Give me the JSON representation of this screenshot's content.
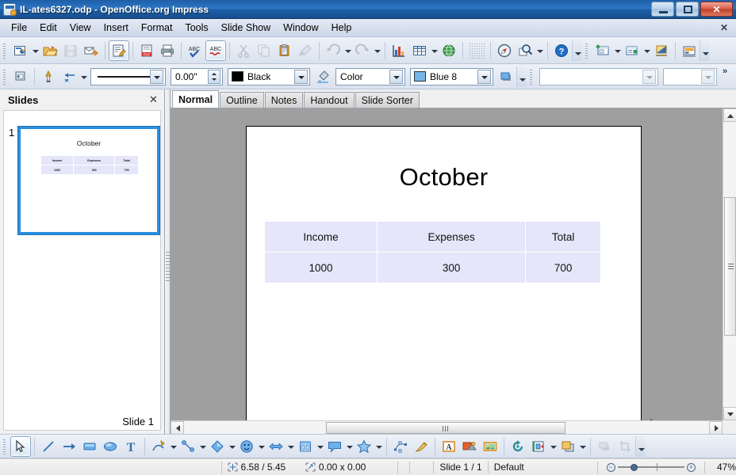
{
  "window": {
    "title": "IL-ates6327.odp - OpenOffice.org Impress",
    "app_icon": "impress-document-icon",
    "controls": {
      "minimize": "minimize-button",
      "restore": "restore-button",
      "close": "✕"
    }
  },
  "menubar": {
    "items": [
      "File",
      "Edit",
      "View",
      "Insert",
      "Format",
      "Tools",
      "Slide Show",
      "Window",
      "Help"
    ],
    "doc_close": "✕"
  },
  "toolbars": {
    "standard": [
      {
        "name": "new-document-icon",
        "kind": "icon",
        "dim": false
      },
      {
        "name": "new-document-dropdown",
        "kind": "arrow"
      },
      {
        "name": "open-icon",
        "kind": "icon",
        "dim": false
      },
      {
        "name": "save-icon",
        "kind": "icon",
        "dim": true
      },
      {
        "name": "email-document-icon",
        "kind": "icon",
        "dim": false
      },
      {
        "name": "separator",
        "kind": "sep"
      },
      {
        "name": "edit-file-icon",
        "kind": "icon",
        "dim": false,
        "pressed": true
      },
      {
        "name": "separator",
        "kind": "sep"
      },
      {
        "name": "export-pdf-icon",
        "kind": "icon",
        "dim": false
      },
      {
        "name": "print-icon",
        "kind": "icon",
        "dim": false
      },
      {
        "name": "separator",
        "kind": "sep"
      },
      {
        "name": "spellcheck-icon",
        "kind": "icon",
        "dim": false
      },
      {
        "name": "autospellcheck-icon",
        "kind": "icon",
        "dim": false,
        "pressed": true
      },
      {
        "name": "separator",
        "kind": "sep"
      },
      {
        "name": "cut-icon",
        "kind": "icon",
        "dim": true
      },
      {
        "name": "copy-icon",
        "kind": "icon",
        "dim": true
      },
      {
        "name": "paste-icon",
        "kind": "icon",
        "dim": false
      },
      {
        "name": "clone-formatting-icon",
        "kind": "icon",
        "dim": true
      },
      {
        "name": "separator",
        "kind": "sep"
      },
      {
        "name": "undo-icon",
        "kind": "icon",
        "dim": true
      },
      {
        "name": "undo-dropdown",
        "kind": "arrow"
      },
      {
        "name": "redo-icon",
        "kind": "icon",
        "dim": true
      },
      {
        "name": "redo-dropdown",
        "kind": "arrow"
      },
      {
        "name": "separator",
        "kind": "sep"
      },
      {
        "name": "insert-chart-icon",
        "kind": "icon",
        "dim": false
      },
      {
        "name": "insert-table-icon",
        "kind": "icon",
        "dim": false
      },
      {
        "name": "insert-table-dropdown",
        "kind": "arrow"
      },
      {
        "name": "hyperlink-icon",
        "kind": "icon",
        "dim": false
      },
      {
        "name": "separator",
        "kind": "sep"
      },
      {
        "name": "display-grid-icon",
        "kind": "dots"
      },
      {
        "name": "separator",
        "kind": "sep"
      },
      {
        "name": "navigator-icon",
        "kind": "icon",
        "dim": false
      },
      {
        "name": "zoom-icon",
        "kind": "icon",
        "dim": false
      },
      {
        "name": "zoom-dropdown",
        "kind": "arrow"
      },
      {
        "name": "separator",
        "kind": "sep"
      },
      {
        "name": "help-icon",
        "kind": "icon",
        "dim": false
      },
      {
        "name": "standard-toolbar-overflow",
        "kind": "overflow"
      },
      {
        "name": "grip",
        "kind": "grip"
      },
      {
        "name": "new-slide-icon",
        "kind": "icon",
        "dim": false
      },
      {
        "name": "new-slide-dropdown",
        "kind": "arrow"
      },
      {
        "name": "slide-layout-icon",
        "kind": "icon",
        "dim": false
      },
      {
        "name": "slide-layout-dropdown",
        "kind": "arrow"
      },
      {
        "name": "start-slideshow-icon",
        "kind": "icon",
        "dim": false
      },
      {
        "name": "separator",
        "kind": "sep"
      },
      {
        "name": "master-slide-icon",
        "kind": "icon",
        "dim": false
      },
      {
        "name": "presentation-toolbar-overflow",
        "kind": "overflow"
      }
    ],
    "line_and_filling": {
      "position_size_icon": "position-and-size-icon",
      "line_icon": "line-style-icon",
      "arrow_icon": "arrow-style-icon",
      "line_style_value": "",
      "line_width_value": "0.00\"",
      "line_color_label": "Black",
      "line_color_hex": "#000000",
      "area_style_icon": "area-style-icon",
      "fill_type_label": "Color",
      "fill_color_label": "Blue 8",
      "fill_color_hex": "#76b5e8",
      "shadow_icon": "shadow-icon",
      "table_style_value": "",
      "table_border_value": "",
      "overflow": "»"
    },
    "drawing": [
      {
        "name": "select-tool-icon",
        "kind": "icon",
        "pressed": true
      },
      {
        "name": "separator",
        "kind": "sep"
      },
      {
        "name": "line-tool-icon",
        "kind": "icon"
      },
      {
        "name": "arrow-tool-icon",
        "kind": "icon"
      },
      {
        "name": "rectangle-tool-icon",
        "kind": "icon"
      },
      {
        "name": "ellipse-tool-icon",
        "kind": "icon"
      },
      {
        "name": "text-tool-icon",
        "kind": "icon"
      },
      {
        "name": "separator",
        "kind": "sep"
      },
      {
        "name": "curve-tool-icon",
        "kind": "icon"
      },
      {
        "name": "curve-dropdown",
        "kind": "arrow"
      },
      {
        "name": "connector-tool-icon",
        "kind": "icon"
      },
      {
        "name": "connector-dropdown",
        "kind": "arrow"
      },
      {
        "name": "basic-shapes-icon",
        "kind": "icon"
      },
      {
        "name": "basic-shapes-dropdown",
        "kind": "arrow"
      },
      {
        "name": "symbol-shapes-icon",
        "kind": "icon"
      },
      {
        "name": "symbol-shapes-dropdown",
        "kind": "arrow"
      },
      {
        "name": "block-arrows-icon",
        "kind": "icon"
      },
      {
        "name": "block-arrows-dropdown",
        "kind": "arrow"
      },
      {
        "name": "flowchart-shapes-icon",
        "kind": "icon"
      },
      {
        "name": "flowchart-dropdown",
        "kind": "arrow"
      },
      {
        "name": "callout-shapes-icon",
        "kind": "icon"
      },
      {
        "name": "callout-dropdown",
        "kind": "arrow"
      },
      {
        "name": "stars-shapes-icon",
        "kind": "icon"
      },
      {
        "name": "stars-dropdown",
        "kind": "arrow"
      },
      {
        "name": "separator",
        "kind": "sep"
      },
      {
        "name": "edit-points-icon",
        "kind": "icon"
      },
      {
        "name": "glue-points-icon",
        "kind": "icon"
      },
      {
        "name": "separator",
        "kind": "sep"
      },
      {
        "name": "fontwork-icon",
        "kind": "icon"
      },
      {
        "name": "from-file-icon",
        "kind": "icon"
      },
      {
        "name": "gallery-icon",
        "kind": "icon"
      },
      {
        "name": "separator",
        "kind": "sep"
      },
      {
        "name": "rotate-icon",
        "kind": "icon"
      },
      {
        "name": "alignment-icon",
        "kind": "icon"
      },
      {
        "name": "alignment-dropdown",
        "kind": "arrow"
      },
      {
        "name": "arrange-icon",
        "kind": "icon"
      },
      {
        "name": "arrange-dropdown",
        "kind": "arrow"
      },
      {
        "name": "separator",
        "kind": "sep"
      },
      {
        "name": "shadow-tool-icon",
        "kind": "icon",
        "dim": true
      },
      {
        "name": "crop-image-icon",
        "kind": "icon",
        "dim": true
      },
      {
        "name": "drawing-toolbar-overflow",
        "kind": "overflow"
      }
    ]
  },
  "slides_panel": {
    "title": "Slides",
    "close": "✕",
    "slide_number": "1",
    "footer_label": "Slide 1",
    "thumbnail": {
      "title": "October",
      "table": {
        "headers": [
          "Income",
          "Expenses",
          "Total"
        ],
        "rows": [
          [
            "1000",
            "300",
            "700"
          ]
        ]
      }
    }
  },
  "view_tabs": [
    {
      "label": "Normal",
      "active": true
    },
    {
      "label": "Outline",
      "active": false
    },
    {
      "label": "Notes",
      "active": false
    },
    {
      "label": "Handout",
      "active": false
    },
    {
      "label": "Slide Sorter",
      "active": false
    }
  ],
  "slide": {
    "title": "October",
    "table": {
      "headers": [
        "Income",
        "Expenses",
        "Total"
      ],
      "rows": [
        [
          "1000",
          "300",
          "700"
        ]
      ],
      "cell_fill_hex": "#e6e6fa"
    }
  },
  "statusbar": {
    "cursor_position": "6.58 / 5.45",
    "object_size": "0.00 x 0.00",
    "slide_indicator": "Slide 1 / 1",
    "master_name": "Default",
    "zoom_minus": "−",
    "zoom_plus": "+",
    "zoom_level": "47%"
  },
  "colors": {
    "titlebar_blue": "#2d76c4",
    "close_red": "#c1432d",
    "thumb_selection": "#2a8fe0",
    "canvas_gray": "#9f9f9f",
    "table_lavender": "#e6e6fa"
  }
}
